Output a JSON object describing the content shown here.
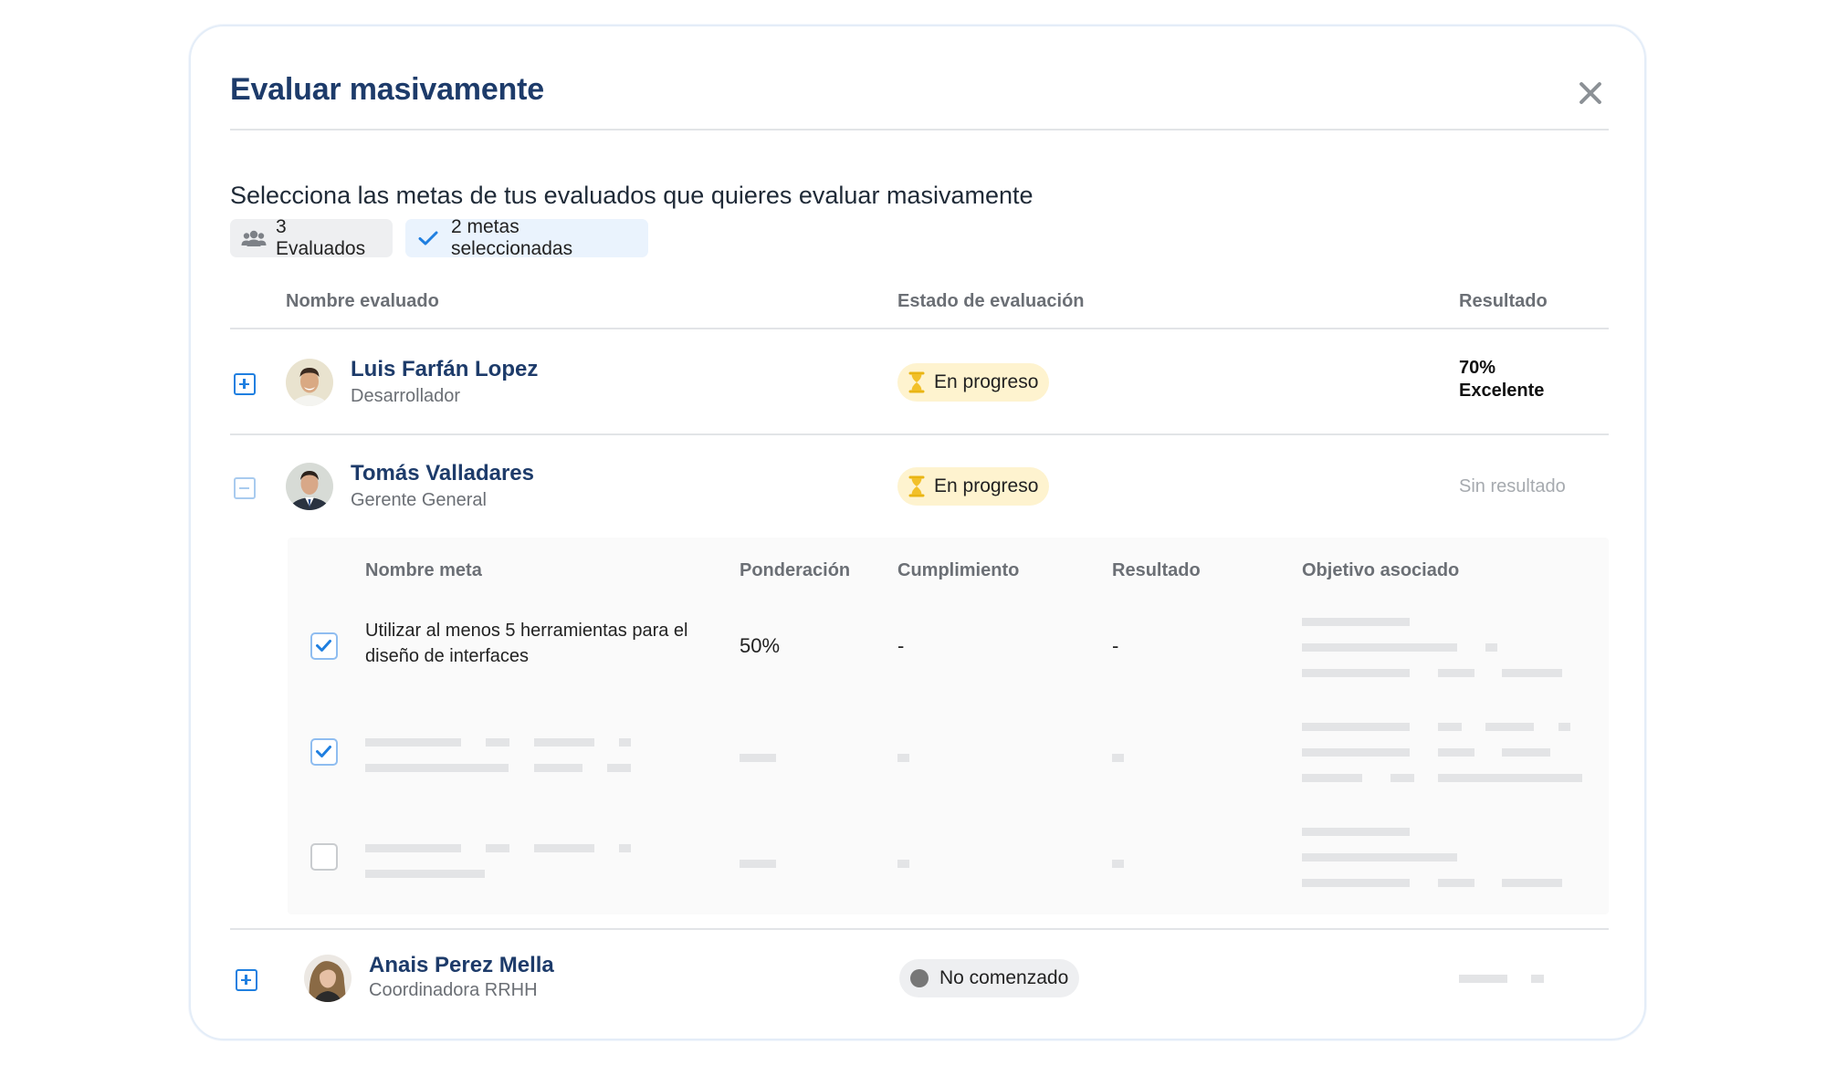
{
  "modal": {
    "title": "Evaluar masivamente",
    "subtitle": "Selecciona las metas de tus evaluados que quieres evaluar masivamente",
    "chips": {
      "evaluados": "3 Evaluados",
      "metas": "2 metas seleccionadas"
    }
  },
  "table": {
    "headers": {
      "name": "Nombre evaluado",
      "status": "Estado de evaluación",
      "result": "Resultado"
    },
    "rows": [
      {
        "name": "Luis Farfán Lopez",
        "role": "Desarrollador",
        "status": "En progreso",
        "result_pct": "70%",
        "result_label": "Excelente",
        "expanded": false
      },
      {
        "name": "Tomás Valladares",
        "role": "Gerente General",
        "status": "En progreso",
        "result": "Sin resultado",
        "expanded": true
      },
      {
        "name": "Anais Perez Mella",
        "role": "Coordinadora RRHH",
        "status": "No comenzado",
        "expanded": false
      }
    ]
  },
  "goals": {
    "headers": {
      "name": "Nombre meta",
      "weight": "Ponderación",
      "compliance": "Cumplimiento",
      "result": "Resultado",
      "objective": "Objetivo asociado"
    },
    "items": [
      {
        "checked": true,
        "name": "Utilizar al menos 5 herramientas para el diseño de interfaces",
        "weight": "50%",
        "compliance": "-",
        "result": "-"
      },
      {
        "checked": true
      },
      {
        "checked": false
      }
    ]
  },
  "colors": {
    "title": "#1d3b6a",
    "accent": "#1f7fe0",
    "progress_bg": "#fef3cf",
    "hourglass": "#f2c02a"
  },
  "icons": [
    "close-icon",
    "users-icon",
    "check-icon",
    "plus-square-icon",
    "minus-square-icon",
    "hourglass-icon",
    "gray-dot-icon"
  ]
}
